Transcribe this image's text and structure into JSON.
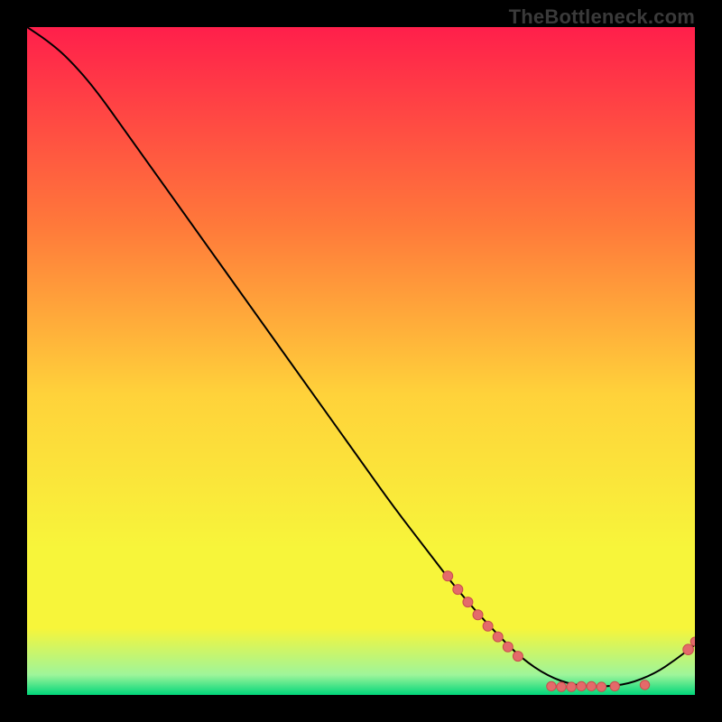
{
  "watermark": "TheBottleneck.com",
  "colors": {
    "gradient_top": "#ff1f4b",
    "gradient_mid_upper": "#ff7a3a",
    "gradient_mid": "#ffd23a",
    "gradient_mid_lower": "#f7f53a",
    "gradient_green_light": "#9ef59a",
    "gradient_green": "#00d67a",
    "dot_fill": "#e46a6a",
    "dot_stroke": "#c94d4d",
    "curve": "#000000"
  },
  "chart_data": {
    "type": "line",
    "title": "",
    "xlabel": "",
    "ylabel": "",
    "xlim": [
      0,
      100
    ],
    "ylim": [
      0,
      100
    ],
    "note": "Axes have no visible tick labels in the source image; x and y here are normalized 0–100 within the plot area. y measures height above the plot baseline.",
    "curve": [
      {
        "x": 0,
        "y": 100
      },
      {
        "x": 3,
        "y": 98
      },
      {
        "x": 6,
        "y": 95.5
      },
      {
        "x": 10,
        "y": 91
      },
      {
        "x": 15,
        "y": 84
      },
      {
        "x": 20,
        "y": 77
      },
      {
        "x": 25,
        "y": 70
      },
      {
        "x": 30,
        "y": 63
      },
      {
        "x": 35,
        "y": 56
      },
      {
        "x": 40,
        "y": 49
      },
      {
        "x": 45,
        "y": 42
      },
      {
        "x": 50,
        "y": 35
      },
      {
        "x": 55,
        "y": 28
      },
      {
        "x": 60,
        "y": 21.5
      },
      {
        "x": 65,
        "y": 15
      },
      {
        "x": 70,
        "y": 9.5
      },
      {
        "x": 74,
        "y": 5.5
      },
      {
        "x": 78,
        "y": 2.8
      },
      {
        "x": 82,
        "y": 1.4
      },
      {
        "x": 86,
        "y": 1.2
      },
      {
        "x": 90,
        "y": 1.6
      },
      {
        "x": 94,
        "y": 3.2
      },
      {
        "x": 97,
        "y": 5.2
      },
      {
        "x": 100,
        "y": 7.5
      }
    ],
    "dot_clusters": [
      {
        "x": 63,
        "y": 17.8,
        "r": 5.5
      },
      {
        "x": 64.5,
        "y": 15.8,
        "r": 5.5
      },
      {
        "x": 66,
        "y": 13.9,
        "r": 5.5
      },
      {
        "x": 67.5,
        "y": 12.0,
        "r": 5.5
      },
      {
        "x": 69,
        "y": 10.3,
        "r": 5.5
      },
      {
        "x": 70.5,
        "y": 8.7,
        "r": 5.5
      },
      {
        "x": 72,
        "y": 7.2,
        "r": 5.5
      },
      {
        "x": 73.5,
        "y": 5.8,
        "r": 5.5
      },
      {
        "x": 78.5,
        "y": 1.3,
        "r": 5.2
      },
      {
        "x": 80.0,
        "y": 1.2,
        "r": 5.2
      },
      {
        "x": 81.5,
        "y": 1.2,
        "r": 5.2
      },
      {
        "x": 83.0,
        "y": 1.3,
        "r": 5.2
      },
      {
        "x": 84.5,
        "y": 1.3,
        "r": 5.2
      },
      {
        "x": 86.0,
        "y": 1.2,
        "r": 5.2
      },
      {
        "x": 88.0,
        "y": 1.3,
        "r": 5.2
      },
      {
        "x": 92.5,
        "y": 1.5,
        "r": 5.2
      },
      {
        "x": 99.0,
        "y": 6.8,
        "r": 5.8
      },
      {
        "x": 100.0,
        "y": 8.0,
        "r": 4.8
      }
    ]
  }
}
